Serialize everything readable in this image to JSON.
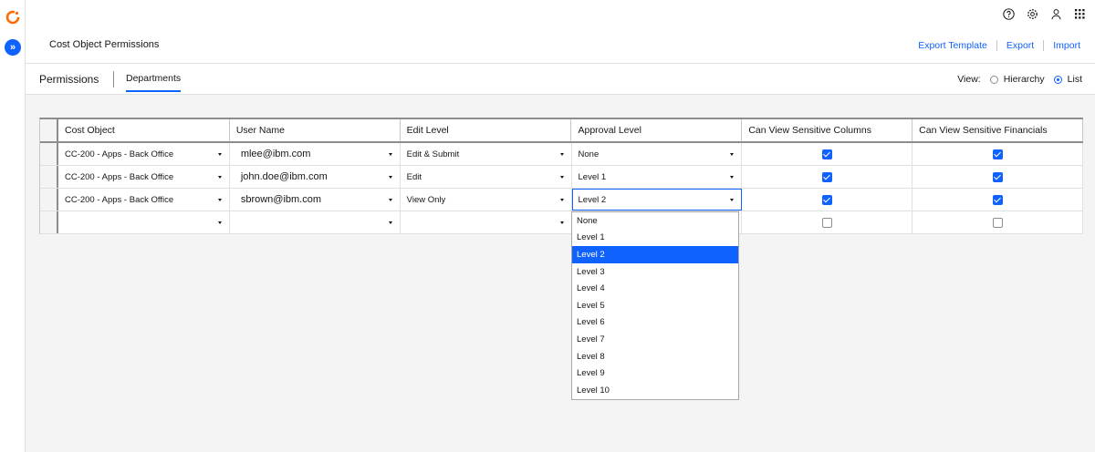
{
  "header": {
    "page_title": "Cost Object Permissions",
    "actions": [
      "Export Template",
      "Export",
      "Import"
    ],
    "icons": [
      "help-icon",
      "settings-icon",
      "user-icon",
      "app-switcher-icon"
    ]
  },
  "tabs": {
    "permissions": "Permissions",
    "departments": "Departments"
  },
  "view": {
    "label": "View:",
    "options": [
      "Hierarchy",
      "List"
    ],
    "selected": "List"
  },
  "grid": {
    "columns": [
      "Cost Object",
      "User Name",
      "Edit Level",
      "Approval Level",
      "Can View Sensitive Columns",
      "Can View Sensitive Financials"
    ],
    "rows": [
      {
        "cost_object": "CC-200 - Apps - Back Office",
        "user": "mlee@ibm.com",
        "edit": "Edit & Submit",
        "approval": "None",
        "sens_cols": true,
        "sens_fin": true
      },
      {
        "cost_object": "CC-200 - Apps - Back Office",
        "user": "john.doe@ibm.com",
        "edit": "Edit",
        "approval": "Level 1",
        "sens_cols": true,
        "sens_fin": true
      },
      {
        "cost_object": "CC-200 - Apps - Back Office",
        "user": "sbrown@ibm.com",
        "edit": "View Only",
        "approval": "Level 2",
        "sens_cols": true,
        "sens_fin": true
      },
      {
        "cost_object": "",
        "user": "",
        "edit": "",
        "approval": "",
        "sens_cols": false,
        "sens_fin": false
      }
    ]
  },
  "dropdown": {
    "options": [
      "None",
      "Level 1",
      "Level 2",
      "Level 3",
      "Level 4",
      "Level 5",
      "Level 6",
      "Level 7",
      "Level 8",
      "Level 9",
      "Level 10"
    ],
    "selected": "Level 2"
  },
  "colors": {
    "accent": "#0f62fe"
  }
}
